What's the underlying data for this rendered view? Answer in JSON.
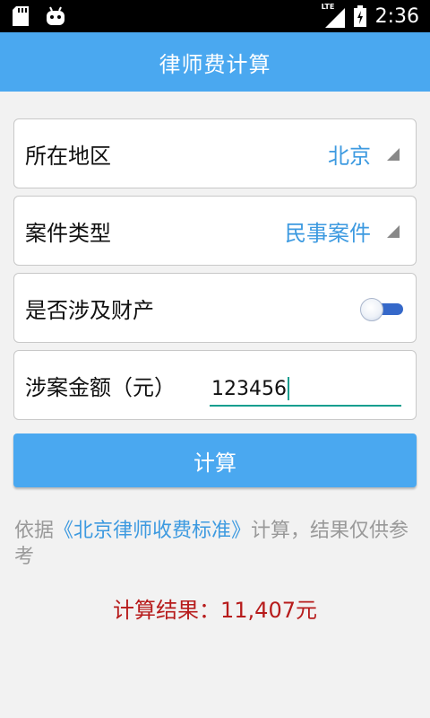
{
  "status_bar": {
    "network": "LTE",
    "time": "2:36"
  },
  "app_bar": {
    "title": "律师费计算"
  },
  "form": {
    "region": {
      "label": "所在地区",
      "value": "北京"
    },
    "case_type": {
      "label": "案件类型",
      "value": "民事案件"
    },
    "involves_property": {
      "label": "是否涉及财产",
      "checked": false
    },
    "amount": {
      "label": "涉案金额（元）",
      "value": "123456"
    }
  },
  "calculate_button": {
    "label": "计算"
  },
  "note": {
    "prefix": "依据",
    "link": "《北京律师收费标准》",
    "suffix": "计算，结果仅供参考"
  },
  "result": {
    "label": "计算结果：",
    "value": "11,407元"
  },
  "colors": {
    "primary": "#4aa8f0",
    "link": "#3d9ae0",
    "result": "#b71c1c",
    "input_underline": "#129e8f"
  }
}
